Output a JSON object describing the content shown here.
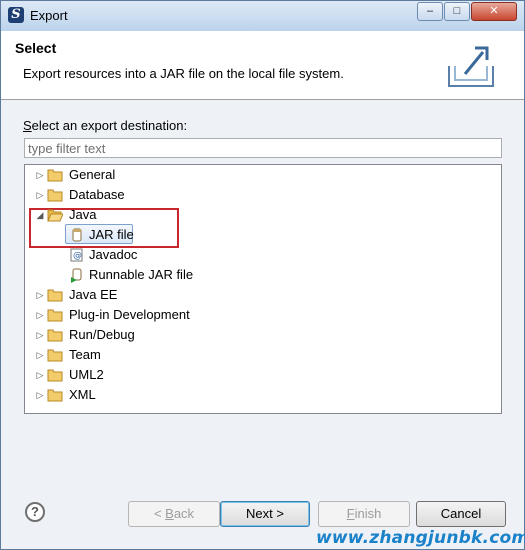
{
  "window": {
    "title": "Export",
    "min_glyph": "–",
    "max_glyph": "□",
    "close_glyph": "✕"
  },
  "header": {
    "title": "Select",
    "description": "Export resources into a JAR file on the local file system."
  },
  "content": {
    "dest_label_accel": "S",
    "dest_label_rest": "elect an export destination:",
    "filter_placeholder": "type filter text"
  },
  "tree": {
    "items": [
      {
        "label": "General",
        "expanded": false,
        "level": 0,
        "icon": "folder-icon"
      },
      {
        "label": "Database",
        "expanded": false,
        "level": 0,
        "icon": "folder-icon"
      },
      {
        "label": "Java",
        "expanded": true,
        "level": 0,
        "icon": "folder-icon"
      },
      {
        "label": "JAR file",
        "level": 1,
        "icon": "jar-file-icon",
        "selected": true
      },
      {
        "label": "Javadoc",
        "level": 1,
        "icon": "javadoc-icon"
      },
      {
        "label": "Runnable JAR file",
        "level": 1,
        "icon": "runnable-jar-icon"
      },
      {
        "label": "Java EE",
        "expanded": false,
        "level": 0,
        "icon": "folder-icon"
      },
      {
        "label": "Plug-in Development",
        "expanded": false,
        "level": 0,
        "icon": "folder-icon"
      },
      {
        "label": "Run/Debug",
        "expanded": false,
        "level": 0,
        "icon": "folder-icon"
      },
      {
        "label": "Team",
        "expanded": false,
        "level": 0,
        "icon": "folder-icon"
      },
      {
        "label": "UML2",
        "expanded": false,
        "level": 0,
        "icon": "folder-icon"
      },
      {
        "label": "XML",
        "expanded": false,
        "level": 0,
        "icon": "folder-icon"
      }
    ]
  },
  "footer": {
    "help_glyph": "?",
    "back_prefix": "< ",
    "back_accel": "B",
    "back_rest": "ack",
    "next_label": "Next >",
    "finish_accel": "F",
    "finish_rest": "inish",
    "cancel_label": "Cancel"
  },
  "watermark": "www.zhangjunbk.com",
  "colors": {
    "highlight_border": "#c8262c",
    "selection_border": "#7da2ce",
    "watermark": "#1b82c9",
    "folder": "#e8b84a"
  }
}
